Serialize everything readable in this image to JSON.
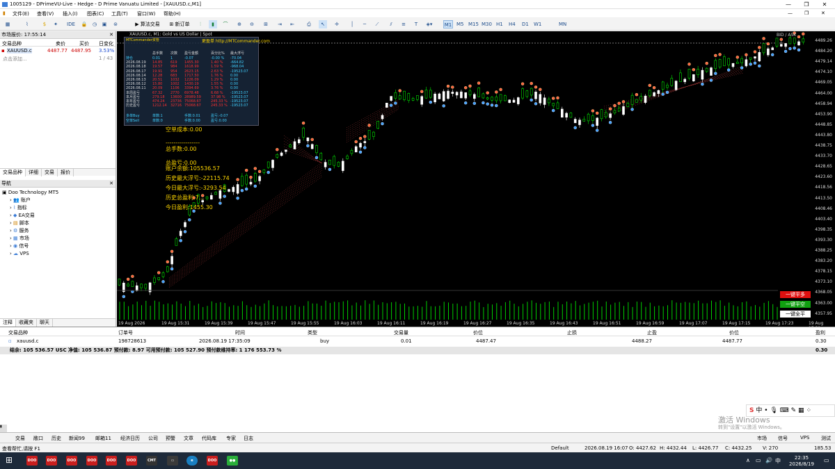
{
  "window": {
    "title": "1005129 - DPrimeVU-Live - Hedge - D Prime Vanuatu Limited - [XAUUSD.c,M1]"
  },
  "menu": [
    "文件(E)",
    "查看(V)",
    "插入(I)",
    "图表(C)",
    "工具(T)",
    "窗口(W)",
    "帮助(H)"
  ],
  "toolbar": {
    "ide": "IDE",
    "algo": "算法交易",
    "neworder": "新订单",
    "timeframes": [
      "M1",
      "M5",
      "M15",
      "M30",
      "H1",
      "H4",
      "D1",
      "W1",
      "MN"
    ],
    "active_tf": "M1"
  },
  "market": {
    "header": "市场报价: 17:55:14",
    "cols": [
      "交易品种",
      "卖价",
      "买价",
      "日变化"
    ],
    "row": {
      "symbol": "XAUUSD.c",
      "bid": "4487.77",
      "ask": "4487.95",
      "chg": "3.53%"
    },
    "add": "点击添加...",
    "count": "1 / 43",
    "tabs": [
      "交易品种",
      "详细",
      "交易",
      "报价"
    ]
  },
  "navigator": {
    "header": "导航",
    "root": "Doo Technology MT5",
    "items": [
      "账户",
      "指标",
      "EA交易",
      "脚本",
      "服务",
      "市场",
      "信号",
      "VPS"
    ],
    "tabs": [
      "注释",
      "收藏夹",
      "聊天"
    ]
  },
  "chart": {
    "header": "XAUUSD.c, M1: Gold vs US Dollar | Spot",
    "link": "更盈单 http://MTCommander.com",
    "ask_tag": "BID / ASK",
    "yticks": [
      "4489.26",
      "4484.20",
      "4479.14",
      "4474.10",
      "4469.05",
      "4464.00",
      "4458.94",
      "4453.90",
      "4448.85",
      "4443.80",
      "4438.75",
      "4433.70",
      "4428.65",
      "4423.60",
      "4418.56",
      "4413.50",
      "4408.46",
      "4403.40",
      "4398.35",
      "4393.30",
      "4388.25",
      "4383.20",
      "4378.15",
      "4373.10",
      "4368.05",
      "4363.00",
      "4357.95"
    ],
    "xticks": [
      "19 Aug 2026",
      "19 Aug 15:31",
      "19 Aug 15:39",
      "19 Aug 15:47",
      "19 Aug 15:55",
      "19 Aug 16:03",
      "19 Aug 16:11",
      "19 Aug 16:19",
      "19 Aug 16:27",
      "19 Aug 16:35",
      "19 Aug 16:43",
      "19 Aug 16:51",
      "19 Aug 16:59",
      "19 Aug 17:07",
      "19 Aug 17:15",
      "19 Aug 17:23",
      "19 Aug 17:31"
    ],
    "text_lines": [
      "空单成本:0.00",
      "-----------------",
      "总手数:0.00",
      "总盈亏:0.00",
      "账户余额:105536.57",
      "历史最大浮亏:-22115.74",
      "今日最大浮亏:-3293.54",
      "历史总盈利:7...",
      "今日盈利:1455.30"
    ],
    "buttons": [
      {
        "label": "一键平多",
        "color": "#e01010"
      },
      {
        "label": "一键平空",
        "color": "#10a010"
      },
      {
        "label": "一键全平",
        "color": "#ffffff"
      }
    ]
  },
  "panel": {
    "title": "MTCommander资管",
    "header": [
      "总手数",
      "次数",
      "盈亏金额",
      "百分比%",
      "最大浮亏"
    ],
    "rows": [
      [
        "持仓",
        "0.01",
        "1",
        "-0.07",
        "-0.00 %",
        "-70.04"
      ],
      [
        "2026.08.19",
        "14.85",
        "619",
        "1455.30",
        "1.40 %",
        "-664.82"
      ],
      [
        "2026.08.18",
        "19.57",
        "984",
        "1618.99",
        "1.59 %",
        "-968.04"
      ],
      [
        "2026.08.17",
        "19.91",
        "954",
        "2623.15",
        "2.63 %",
        "-19523.07"
      ],
      [
        "2026.08.14",
        "12.28",
        "683",
        "1717.50",
        "1.76 %",
        "0.00"
      ],
      [
        "2026.08.13",
        "20.51",
        "1032",
        "1226.09",
        "1.29 %",
        "0.00"
      ],
      [
        "2026.08.12",
        "15.80",
        "1002",
        "1430.19",
        "1.55 %",
        "0.00"
      ],
      [
        "2026.08.11",
        "20.09",
        "1106",
        "3394.69",
        "3.76 %",
        "0.00"
      ],
      [
        "本周盈亏",
        "67.32",
        "2770",
        "6978.48",
        "6.68 %",
        "-19523.07"
      ],
      [
        "本月盈亏",
        "279.18",
        "13600",
        "28989.59",
        "37.98 %",
        "-19523.07"
      ],
      [
        "本年盈亏",
        "474.24",
        "23736",
        "75068.67",
        "245.33 %",
        "-19523.07"
      ],
      [
        "历史盈亏",
        "1212.14",
        "32716",
        "75068.67",
        "245.33 %",
        "-19523.07"
      ]
    ],
    "foot1": [
      "多单Buy",
      "单数:1",
      "手数:0.01",
      "盈亏:-0.07"
    ],
    "foot2": [
      "空单Sell",
      "单数:0",
      "手数:0.00",
      "盈亏:0.00"
    ]
  },
  "orders": {
    "cols": [
      "交易品种",
      "订单号",
      "时间",
      "类型",
      "交易量",
      "价位",
      "止损",
      "止盈",
      "价位",
      "盈利"
    ],
    "row": [
      "xauusd.c",
      "198728613",
      "2026.08.19 17:35:09",
      "buy",
      "0.01",
      "4487.47",
      "",
      "4488.27",
      "4487.77",
      "0.30"
    ],
    "balance": "结余: 105 536.57 USC  净值: 105 536.87  预付款: 8.97  可用预付款: 105 527.90  预付款维持率: 1 176 553.73 %",
    "total": "0.30"
  },
  "bottom_tabs": [
    "交易",
    "敞口",
    "历史",
    "新闻99",
    "邮箱11",
    "经济日历",
    "公司",
    "预警",
    "文章",
    "代码库",
    "专家",
    "日志"
  ],
  "bottom_right": [
    "市场",
    "信号",
    "VPS",
    "测试"
  ],
  "status": {
    "hint": "查看帮忙,请按 F1",
    "profile": "Default",
    "time": "2026.08.19 16:07",
    "o": "O: 4427.62",
    "h": "H: 4432.44",
    "l": "L: 4426.77",
    "c": "C: 4432.25",
    "v": "V: 270",
    "ping": "185.53 ms"
  },
  "watermark": {
    "line1": "激活 Windows",
    "line2": "转到\"设置\"以激活 Windows。"
  },
  "tray": {
    "time": "22:35",
    "date": "2026/8/19",
    "lang": "中"
  }
}
